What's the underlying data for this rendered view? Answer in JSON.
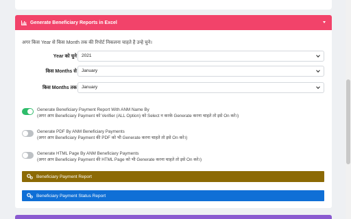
{
  "header": {
    "title": "Generate Beneficiary Reports in Excel",
    "icon": "bar-chart-icon"
  },
  "hint": "अगर किस Year से किस Month तक की रिपोर्ट निकलना चाहते है उन्हे चुने।",
  "fields": [
    {
      "label": "Year को चुने",
      "value": "2021"
    },
    {
      "label": "किस Months से",
      "value": "January"
    },
    {
      "label": "किस Months तक",
      "value": "January"
    }
  ],
  "toggles": [
    {
      "title": "Generate Beneficiary Payment Report With ANM Name By",
      "desc": "(अगर आप Beneficiary Payment को Verifier (ALL Option) को Select न करके Generate करना चाहते तो इसे On करे।)",
      "on": true
    },
    {
      "title": "Generate PDF By ANM Beneficiary Payments",
      "desc": "(अगर आप Beneficiary Payment की PDF को भी Generate करना चाहते तो इसे On करे।)",
      "on": false
    },
    {
      "title": "Generate HTML Page By ANM Beneficiary Payments",
      "desc": "(अगर आप Beneficiary Payment की HTML Page को भी Generate करना चाहते तो इसे On करे।)",
      "on": false
    }
  ],
  "buttons": {
    "beneficiary_payment_report": "Beneficiary Payment Report",
    "beneficiary_payment_status_report": "Beneficiary Payment Status Report"
  },
  "colors": {
    "header": "#f2436a",
    "toggle_on": "#2ebc6a",
    "report_button": "#8c6a05",
    "status_button": "#0f6fd6",
    "next_card": "#8a5ad0"
  }
}
